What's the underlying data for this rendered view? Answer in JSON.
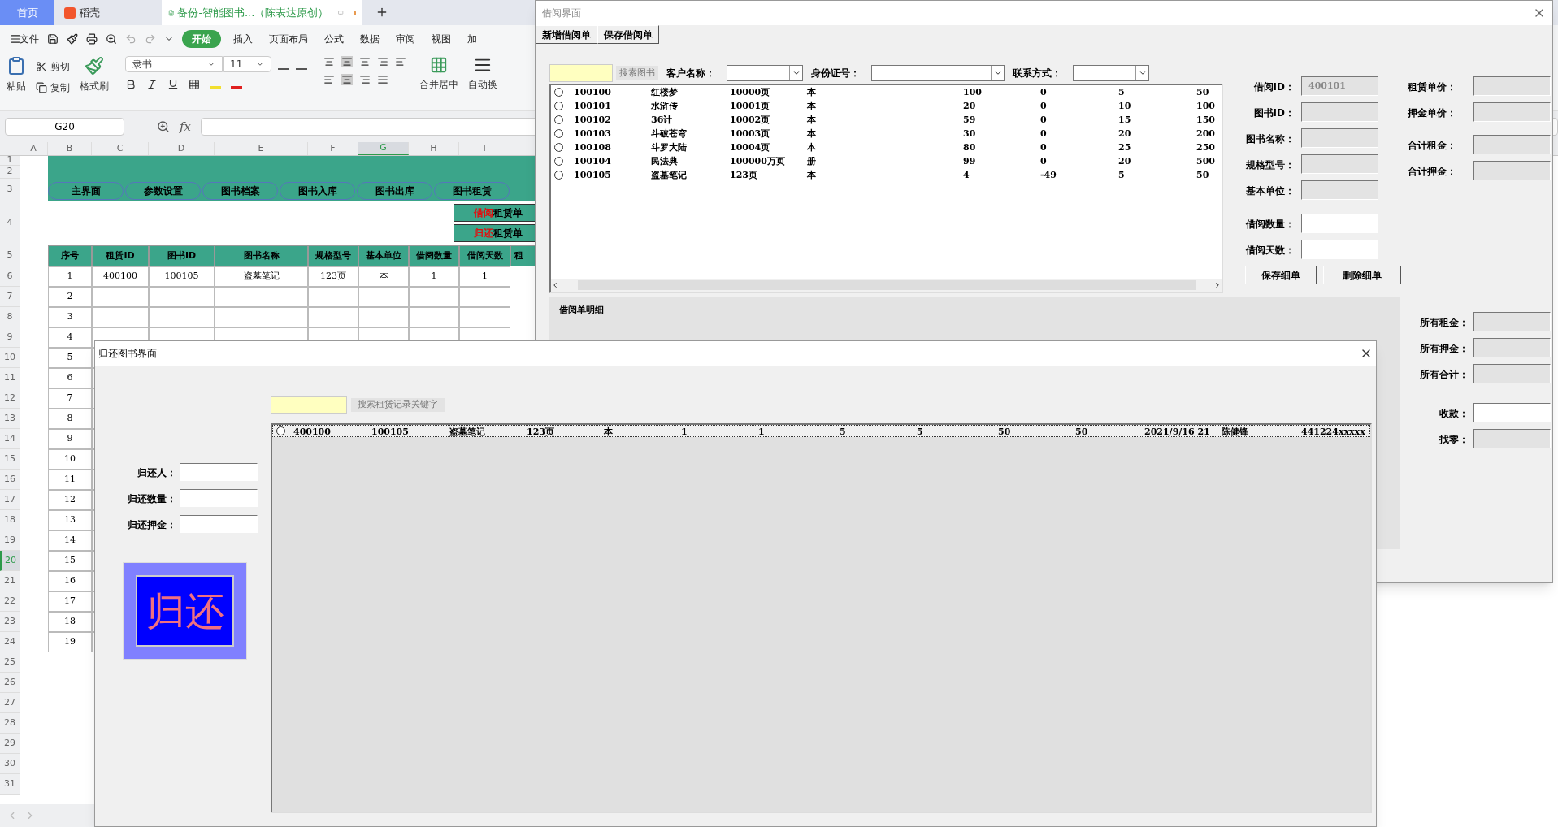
{
  "browser_tabs": [
    {
      "label": "首页",
      "kind": "home",
      "selected": false
    },
    {
      "label": "稻壳",
      "kind": "docer",
      "selected": false
    },
    {
      "label": "备份-智能图书...（陈表达原创）",
      "kind": "sheet",
      "selected": true
    }
  ],
  "menu": {
    "file": "文件",
    "tabs": [
      {
        "label": "开始",
        "selected": true
      },
      {
        "label": "插入",
        "selected": false
      },
      {
        "label": "页面布局",
        "selected": false
      },
      {
        "label": "公式",
        "selected": false
      },
      {
        "label": "数据",
        "selected": false
      },
      {
        "label": "审阅",
        "selected": false
      },
      {
        "label": "视图",
        "selected": false
      },
      {
        "label": "加",
        "selected": false
      }
    ]
  },
  "ribbon": {
    "paste": "粘贴",
    "cut": "剪切",
    "copy": "复制",
    "format_painter": "格式刷",
    "font": "隶书",
    "font_size": "11",
    "merge": "合并居中",
    "wrap": "自动换"
  },
  "formula_bar": {
    "cell": "G20",
    "fx": "fx"
  },
  "columns": [
    {
      "label": "A",
      "selected": false
    },
    {
      "label": "B",
      "selected": false
    },
    {
      "label": "C",
      "selected": false
    },
    {
      "label": "D",
      "selected": false
    },
    {
      "label": "E",
      "selected": false
    },
    {
      "label": "F",
      "selected": false
    },
    {
      "label": "G",
      "selected": true
    },
    {
      "label": "H",
      "selected": false
    },
    {
      "label": "I",
      "selected": false
    }
  ],
  "row_numbers": [
    {
      "label": "1",
      "selected": false
    },
    {
      "label": "2",
      "selected": false
    },
    {
      "label": "3",
      "selected": false
    },
    {
      "label": "4",
      "selected": false
    },
    {
      "label": "5",
      "selected": false
    },
    {
      "label": "6",
      "selected": false
    },
    {
      "label": "7",
      "selected": false
    },
    {
      "label": "8",
      "selected": false
    },
    {
      "label": "9",
      "selected": false
    },
    {
      "label": "10",
      "selected": false
    },
    {
      "label": "11",
      "selected": false
    },
    {
      "label": "12",
      "selected": false
    },
    {
      "label": "13",
      "selected": false
    },
    {
      "label": "14",
      "selected": false
    },
    {
      "label": "15",
      "selected": false
    },
    {
      "label": "16",
      "selected": false
    },
    {
      "label": "17",
      "selected": false
    },
    {
      "label": "18",
      "selected": false
    },
    {
      "label": "19",
      "selected": false
    },
    {
      "label": "20",
      "selected": true
    },
    {
      "label": "21",
      "selected": false
    },
    {
      "label": "22",
      "selected": false
    },
    {
      "label": "23",
      "selected": false
    },
    {
      "label": "24",
      "selected": false
    },
    {
      "label": "25",
      "selected": false
    },
    {
      "label": "26",
      "selected": false
    },
    {
      "label": "27",
      "selected": false
    },
    {
      "label": "28",
      "selected": false
    },
    {
      "label": "29",
      "selected": false
    },
    {
      "label": "30",
      "selected": false
    },
    {
      "label": "31",
      "selected": false
    }
  ],
  "nav_buttons": [
    "主界面",
    "参数设置",
    "图书档案",
    "图书入库",
    "图书出库",
    "图书租赁"
  ],
  "action_buttons": [
    {
      "highlight": "借阅",
      "rest": "租赁单"
    },
    {
      "highlight": "归还",
      "rest": "租赁单"
    }
  ],
  "table": {
    "columns": [
      "序号",
      "租赁ID",
      "图书ID",
      "图书名称",
      "规格型号",
      "基本单位",
      "借阅数量",
      "借阅天数",
      "租"
    ],
    "rows": [
      [
        "1",
        "400100",
        "100105",
        "盗墓笔记",
        "123页",
        "本",
        "1",
        "1"
      ],
      [
        "2"
      ],
      [
        "3"
      ],
      [
        "4"
      ],
      [
        "5"
      ],
      [
        "6"
      ],
      [
        "7"
      ],
      [
        "8"
      ],
      [
        "9"
      ],
      [
        "10"
      ],
      [
        "11"
      ],
      [
        "12"
      ],
      [
        "13"
      ],
      [
        "14"
      ],
      [
        "15"
      ],
      [
        "16"
      ],
      [
        "17"
      ],
      [
        "18"
      ],
      [
        "19"
      ]
    ]
  },
  "borrow_window": {
    "title": "借阅界面",
    "toolbar": [
      "新增借阅单",
      "保存借阅单"
    ],
    "search_button": "搜索图书",
    "filters": [
      "客户名称：",
      "身份证号：",
      "联系方式："
    ],
    "books": [
      {
        "selected": false,
        "cells": [
          "100100",
          "红楼梦",
          "10000页",
          "本",
          "100",
          "0",
          "5",
          "50"
        ]
      },
      {
        "selected": false,
        "cells": [
          "100101",
          "水浒传",
          "10001页",
          "本",
          "20",
          "0",
          "10",
          "100"
        ]
      },
      {
        "selected": false,
        "cells": [
          "100102",
          "36计",
          "10002页",
          "本",
          "59",
          "0",
          "15",
          "150"
        ]
      },
      {
        "selected": false,
        "cells": [
          "100103",
          "斗破苍穹",
          "10003页",
          "本",
          "30",
          "0",
          "20",
          "200"
        ]
      },
      {
        "selected": false,
        "cells": [
          "100108",
          "斗罗大陆",
          "10004页",
          "本",
          "80",
          "0",
          "25",
          "250"
        ]
      },
      {
        "selected": false,
        "cells": [
          "100104",
          "民法典",
          "100000万页",
          "册",
          "99",
          "0",
          "20",
          "500"
        ]
      },
      {
        "selected": false,
        "cells": [
          "100105",
          "盗墓笔记",
          "123页",
          "本",
          "4",
          "-49",
          "5",
          "50"
        ]
      }
    ],
    "detail_fields": [
      {
        "label": "借阅ID：",
        "value": "400101",
        "disabled": true
      },
      {
        "label": "图书ID：",
        "disabled": true
      },
      {
        "label": "图书名称：",
        "disabled": true
      },
      {
        "label": "规格型号：",
        "disabled": true
      },
      {
        "label": "基本单位：",
        "disabled": true
      },
      {
        "label": "借阅数量：",
        "disabled": false
      },
      {
        "label": "借阅天数：",
        "disabled": false
      }
    ],
    "detail_buttons": [
      "保存细单",
      "删除细单"
    ],
    "price_fields": [
      {
        "label": "租赁单价：",
        "disabled": true
      },
      {
        "label": "押金单价：",
        "disabled": true
      },
      {
        "label": "合计租金：",
        "disabled": true
      },
      {
        "label": "合计押金：",
        "disabled": true
      }
    ],
    "detail_list_title": "借阅单明细",
    "totals": [
      {
        "label": "所有租金：",
        "disabled": true
      },
      {
        "label": "所有押金：",
        "disabled": true
      },
      {
        "label": "所有合计：",
        "disabled": true
      },
      {
        "label": "收款：",
        "disabled": false
      },
      {
        "label": "找零：",
        "disabled": true
      }
    ]
  },
  "return_window": {
    "title": "归还图书界面",
    "fields": [
      "归还人：",
      "归还数量：",
      "归还押金："
    ],
    "return_button": "归还",
    "search_button": "搜索租赁记录关键字",
    "records": [
      {
        "selected": false,
        "cells": [
          "400100",
          "100105",
          "盗墓笔记",
          "123页",
          "本",
          "1",
          "1",
          "5",
          "5",
          "50",
          "50",
          "2021/9/16 21",
          "陈健锋",
          "441224xxxxx"
        ]
      }
    ]
  }
}
